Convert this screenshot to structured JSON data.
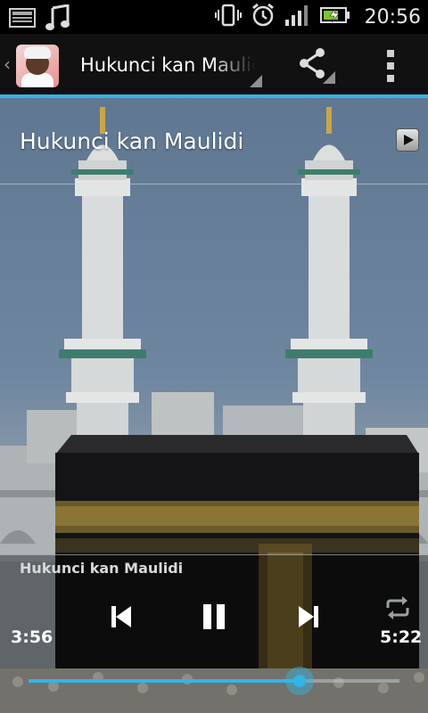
{
  "status_bar": {
    "time": "20:56",
    "icons": [
      "image-icon",
      "music-note-icon",
      "vibrate-icon",
      "alarm-icon",
      "signal-icon",
      "battery-charging-icon"
    ]
  },
  "action_bar": {
    "title": "Hukunci kan Maulidi",
    "back_glyph": "‹",
    "icons": [
      "app-logo",
      "share-icon",
      "overflow-menu-icon"
    ]
  },
  "track_list": {
    "items": [
      {
        "title": "Hukunci kan Maulidi",
        "icon": "play-icon"
      }
    ]
  },
  "player": {
    "now_playing": "Hukunci kan Maulidi",
    "elapsed": "3:56",
    "total": "5:22",
    "progress": 0.73,
    "controls": [
      "previous-icon",
      "pause-icon",
      "next-icon",
      "repeat-icon"
    ]
  },
  "colors": {
    "accent": "#33b5e5",
    "status_bar_bg": "#000000",
    "action_bar_bg": "#111111"
  }
}
